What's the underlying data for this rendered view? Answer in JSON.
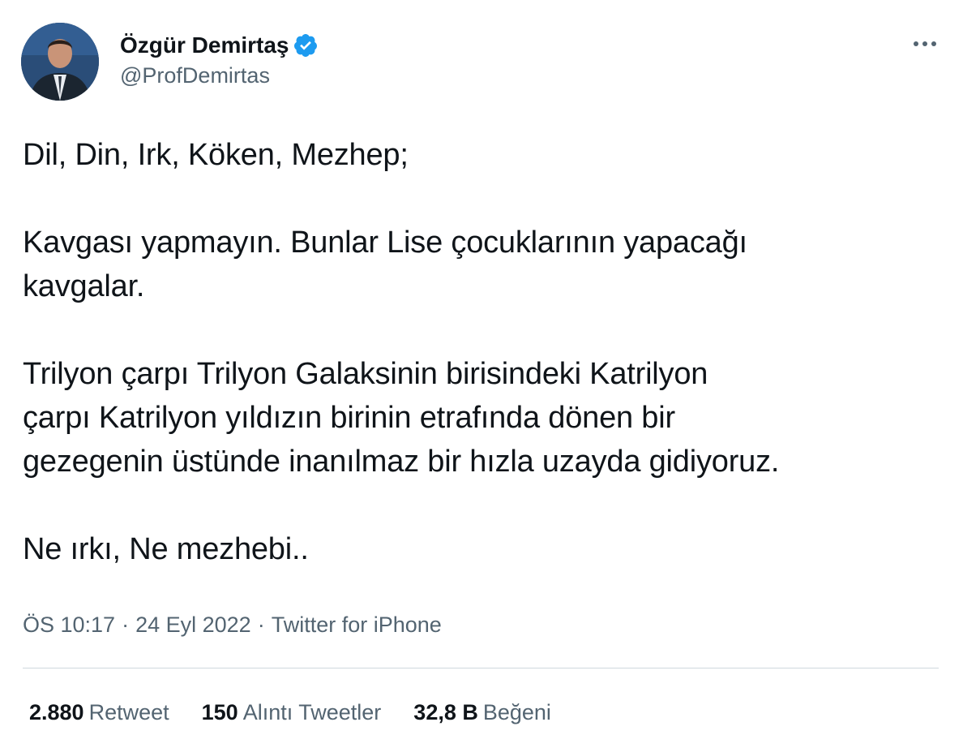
{
  "author": {
    "display_name": "Özgür Demirtaş",
    "handle": "@ProfDemirtas",
    "verified": true,
    "avatar_icon": "profile-photo",
    "verified_icon": "verified-badge-icon",
    "verified_color": "#1d9bf0"
  },
  "more_icon": "more-horizontal-icon",
  "tweet": {
    "text": "Dil, Din, Irk, Köken, Mezhep;\n\nKavgası yapmayın. Bunlar Lise çocuklarının yapacağı\nkavgalar.\n\nTrilyon çarpı Trilyon Galaksinin birisindeki Katrilyon\nçarpı Katrilyon yıldızın birinin etrafında dönen bir\ngezegenin üstünde inanılmaz bir hızla uzayda gidiyoruz.\n\nNe ırkı, Ne mezhebi.."
  },
  "meta": {
    "time": "ÖS 10:17",
    "date": "24 Eyl 2022",
    "source": "Twitter for iPhone",
    "separator": "·"
  },
  "stats": [
    {
      "value": "2.880",
      "label": "Retweet"
    },
    {
      "value": "150",
      "label": "Alıntı Tweetler"
    },
    {
      "value": "32,8 B",
      "label": "Beğeni"
    }
  ],
  "colors": {
    "text_primary": "#0f1419",
    "text_secondary": "#536471",
    "divider": "#cfd9de"
  }
}
